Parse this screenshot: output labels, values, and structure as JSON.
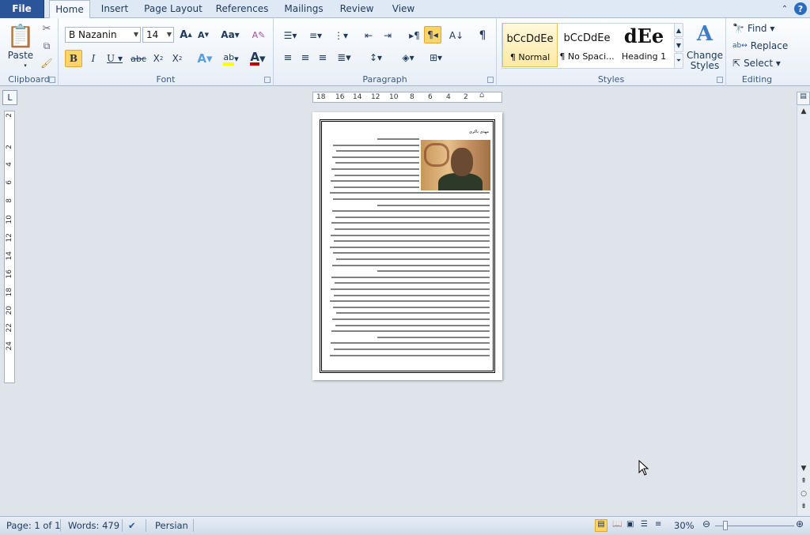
{
  "ribbon_tabs": [
    "File",
    "Home",
    "Insert",
    "Page Layout",
    "References",
    "Mailings",
    "Review",
    "View"
  ],
  "clipboard": {
    "paste_label": "Paste",
    "group_label": "Clipboard"
  },
  "font": {
    "name": "B Nazanin",
    "size": "14",
    "group_label": "Font",
    "font_color": "#c00000",
    "highlight_color": "#ffff00"
  },
  "paragraph": {
    "group_label": "Paragraph"
  },
  "styles": {
    "group_label": "Styles",
    "items": [
      {
        "preview": "bCcDdEe",
        "name": "¶ Normal"
      },
      {
        "preview": "bCcDdEe",
        "name": "¶ No Spaci..."
      },
      {
        "preview": "dEe",
        "name": "Heading 1"
      }
    ],
    "change_styles": [
      "Change",
      "Styles"
    ]
  },
  "editing": {
    "group_label": "Editing",
    "find": "Find",
    "replace": "Replace",
    "select": "Select"
  },
  "ruler": {
    "h_ticks": [
      "18",
      "16",
      "14",
      "12",
      "10",
      "8",
      "6",
      "4",
      "2"
    ],
    "v_ticks": [
      "2",
      "2",
      "4",
      "6",
      "8",
      "10",
      "12",
      "14",
      "16",
      "18",
      "20",
      "22",
      "24"
    ]
  },
  "document": {
    "title": "مهدی باکری"
  },
  "status": {
    "page": "Page: 1 of 1",
    "words": "Words: 479",
    "language": "Persian",
    "zoom": "30%"
  },
  "colors": {
    "accent": "#2a5699",
    "ribbon_bg": "#dfe9f5"
  }
}
